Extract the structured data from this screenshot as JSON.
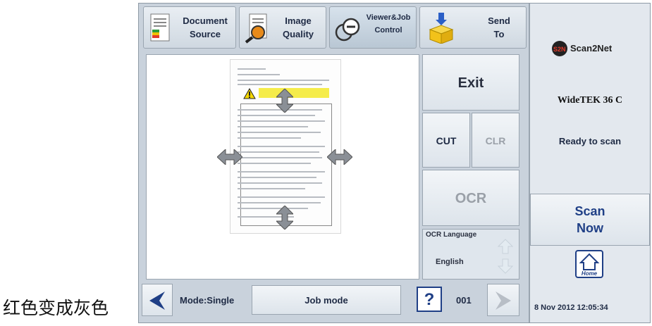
{
  "caption": "红色变成灰色",
  "toolbar": {
    "document_source": {
      "line1": "Document",
      "line2": "Source"
    },
    "image_quality": {
      "line1": "Image",
      "line2": "Quality"
    },
    "viewer_job": {
      "line1": "Viewer&Job",
      "line2": "Control"
    },
    "send_to": {
      "line1": "Send",
      "line2": "To"
    }
  },
  "controls": {
    "exit": "Exit",
    "cut": "CUT",
    "clr": "CLR",
    "ocr": "OCR",
    "ocr_language_label": "OCR Language",
    "ocr_language_value": "English"
  },
  "side": {
    "brand": "Scan2Net",
    "model": "WideTEK 36 C",
    "status": "Ready to scan",
    "scan_line1": "Scan",
    "scan_line2": "Now",
    "home_label": "Home",
    "datetime": "8 Nov 2012 12:05:34"
  },
  "bottom": {
    "mode": "Mode:Single",
    "job_mode": "Job mode",
    "help": "?",
    "counter": "001"
  },
  "colors": {
    "panel_bg": "#c9d2dc",
    "button_text": "#1e2a44",
    "disabled_text": "#9aa0a8"
  }
}
